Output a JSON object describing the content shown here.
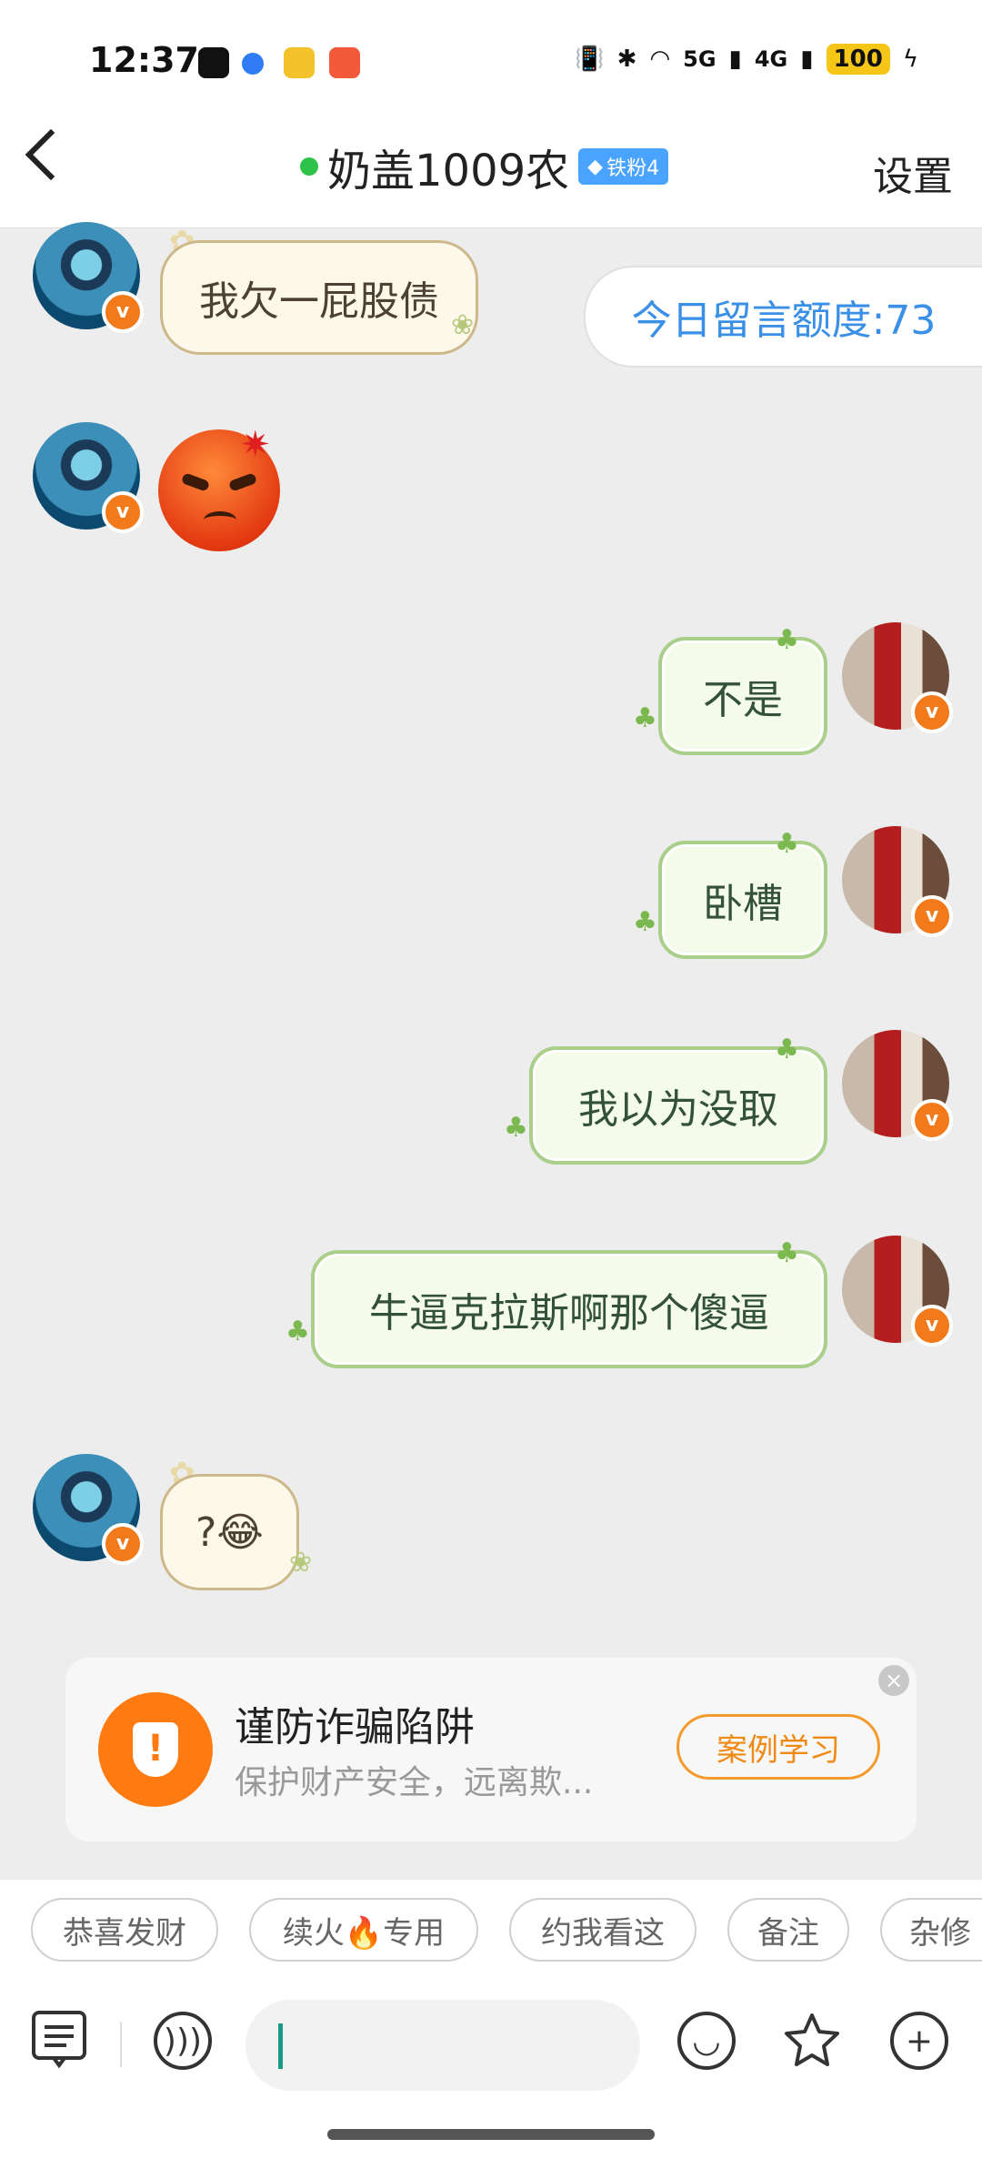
{
  "status_bar": {
    "time": "12:37",
    "network_1": "5G",
    "network_2": "4G",
    "battery": "100"
  },
  "header": {
    "title": "奶盖1009农",
    "fan_badge": "铁粉4",
    "settings_label": "设置"
  },
  "quota_text": "今日留言额度:73",
  "messages": [
    {
      "side": "in",
      "text": "我欠一屁股债"
    },
    {
      "side": "in",
      "type": "emoji",
      "emoji": "angry-face"
    },
    {
      "side": "out",
      "text": "不是"
    },
    {
      "side": "out",
      "text": "卧槽"
    },
    {
      "side": "out",
      "text": "我以为没取"
    },
    {
      "side": "out",
      "text": "牛逼克拉斯啊那个傻逼"
    },
    {
      "side": "in",
      "text": "?😂"
    }
  ],
  "fraud_card": {
    "title": "谨防诈骗陷阱",
    "subtitle": "保护财产安全，远离欺...",
    "button": "案例学习",
    "icon_mark": "!"
  },
  "quick_replies": [
    "恭喜发财",
    "续火🔥专用",
    "约我看这",
    "备注",
    "杂修"
  ],
  "input": {
    "placeholder": ""
  },
  "colors": {
    "accent_orange": "#ff7a10",
    "quota_blue": "#3a8fe6",
    "online_green": "#2ec24a"
  }
}
